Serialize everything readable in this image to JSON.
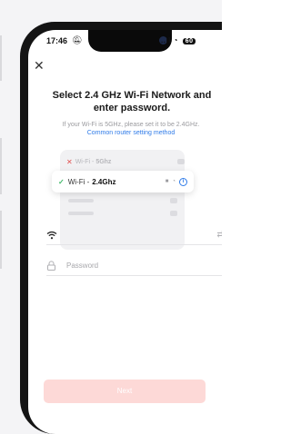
{
  "status_bar": {
    "time": "17:46",
    "signal_label": "..ıl",
    "battery_label": "60"
  },
  "title": "Select 2.4 GHz Wi-Fi Network and enter password.",
  "hint_text": "If your Wi-Fi is 5GHz, please set it to be 2.4GHz.",
  "hint_link": "Common router setting method",
  "illustration": {
    "bad_network": {
      "prefix": "Wi-Fi - ",
      "band": "5Ghz"
    },
    "good_network": {
      "prefix": "Wi-Fi - ",
      "band": "2.4Ghz"
    }
  },
  "wifi_field": {
    "value": ""
  },
  "password_field": {
    "placeholder": "Password",
    "value": ""
  },
  "next_button": {
    "label": "Next"
  },
  "colors": {
    "accent_blue": "#2f7be8",
    "check_green": "#43b96b",
    "error_red": "#e25050",
    "button_disabled": "#fdd9d7"
  }
}
